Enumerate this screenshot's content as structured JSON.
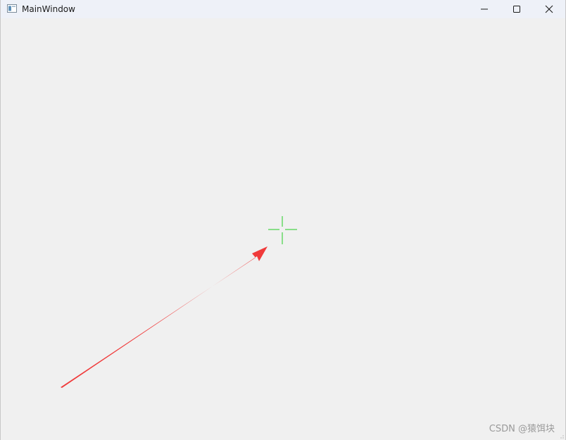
{
  "window": {
    "title": "MainWindow",
    "icon": "qt-window-icon",
    "controls": {
      "minimize_icon": "minimize-icon",
      "maximize_icon": "maximize-icon",
      "close_icon": "close-icon"
    }
  },
  "canvas": {
    "background": "#f0f0f0",
    "crosshair_color": "#22cc22",
    "arrow_color": "#f03a3a"
  },
  "watermark": "CSDN @猿饵块"
}
